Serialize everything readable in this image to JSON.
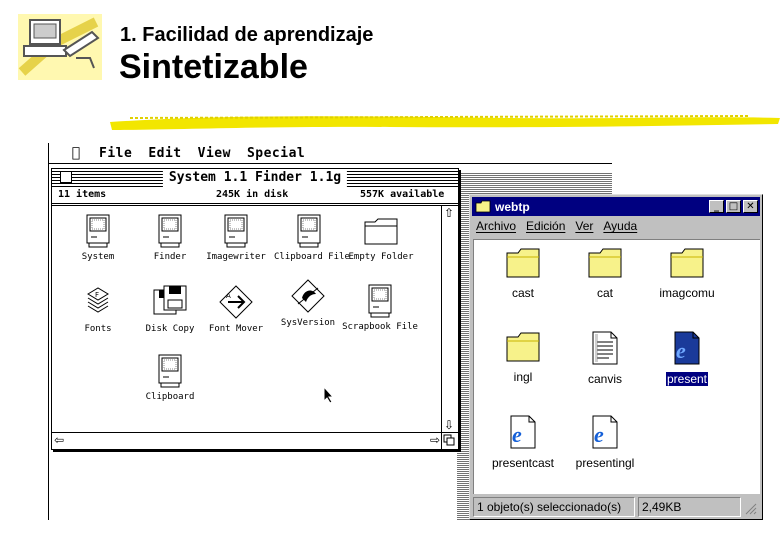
{
  "slide": {
    "subtitle": "1. Facilidad de aprendizaje",
    "title": "Sintetizable"
  },
  "colors": {
    "highlighter_yellow": "#f2e600",
    "win_title_blue": "#000080",
    "win_gray": "#c0c0c0",
    "folder_yellow": "#f7f28a"
  },
  "mac": {
    "menu": [
      "File",
      "Edit",
      "View",
      "Special"
    ],
    "window": {
      "title": "System 1.1 Finder 1.1g",
      "items_count": "11 items",
      "in_disk": "245K in disk",
      "available": "557K available"
    },
    "icons": [
      {
        "label": "System",
        "icon": "mac-computer-icon"
      },
      {
        "label": "Finder",
        "icon": "mac-computer-icon"
      },
      {
        "label": "Imagewriter",
        "icon": "mac-computer-icon"
      },
      {
        "label": "Clipboard File",
        "icon": "mac-computer-icon"
      },
      {
        "label": "Empty Folder",
        "icon": "folder-icon"
      },
      {
        "label": "Fonts",
        "icon": "fonts-suitcase-icon"
      },
      {
        "label": "Disk Copy",
        "icon": "floppy-disk-icon"
      },
      {
        "label": "Font Mover",
        "icon": "font-mover-icon"
      },
      {
        "label": "SysVersion",
        "icon": "sysversion-icon"
      },
      {
        "label": "Scrapbook File",
        "icon": "mac-computer-icon"
      },
      {
        "label": "Clipboard",
        "icon": "mac-computer-icon"
      }
    ]
  },
  "win": {
    "title": "webtp",
    "menu": [
      "Archivo",
      "Edición",
      "Ver",
      "Ayuda"
    ],
    "items": [
      {
        "label": "cast",
        "icon": "folder-icon"
      },
      {
        "label": "cat",
        "icon": "folder-icon"
      },
      {
        "label": "imagcomu",
        "icon": "folder-icon"
      },
      {
        "label": "ingl",
        "icon": "folder-icon"
      },
      {
        "label": "canvis",
        "icon": "text-document-icon"
      },
      {
        "label": "present",
        "icon": "ie-document-icon",
        "selected": true
      },
      {
        "label": "presentcast",
        "icon": "ie-document-icon"
      },
      {
        "label": "presentingl",
        "icon": "ie-document-icon"
      }
    ],
    "status": {
      "selection": "1 objeto(s) seleccionado(s)",
      "size": "2,49KB"
    }
  }
}
